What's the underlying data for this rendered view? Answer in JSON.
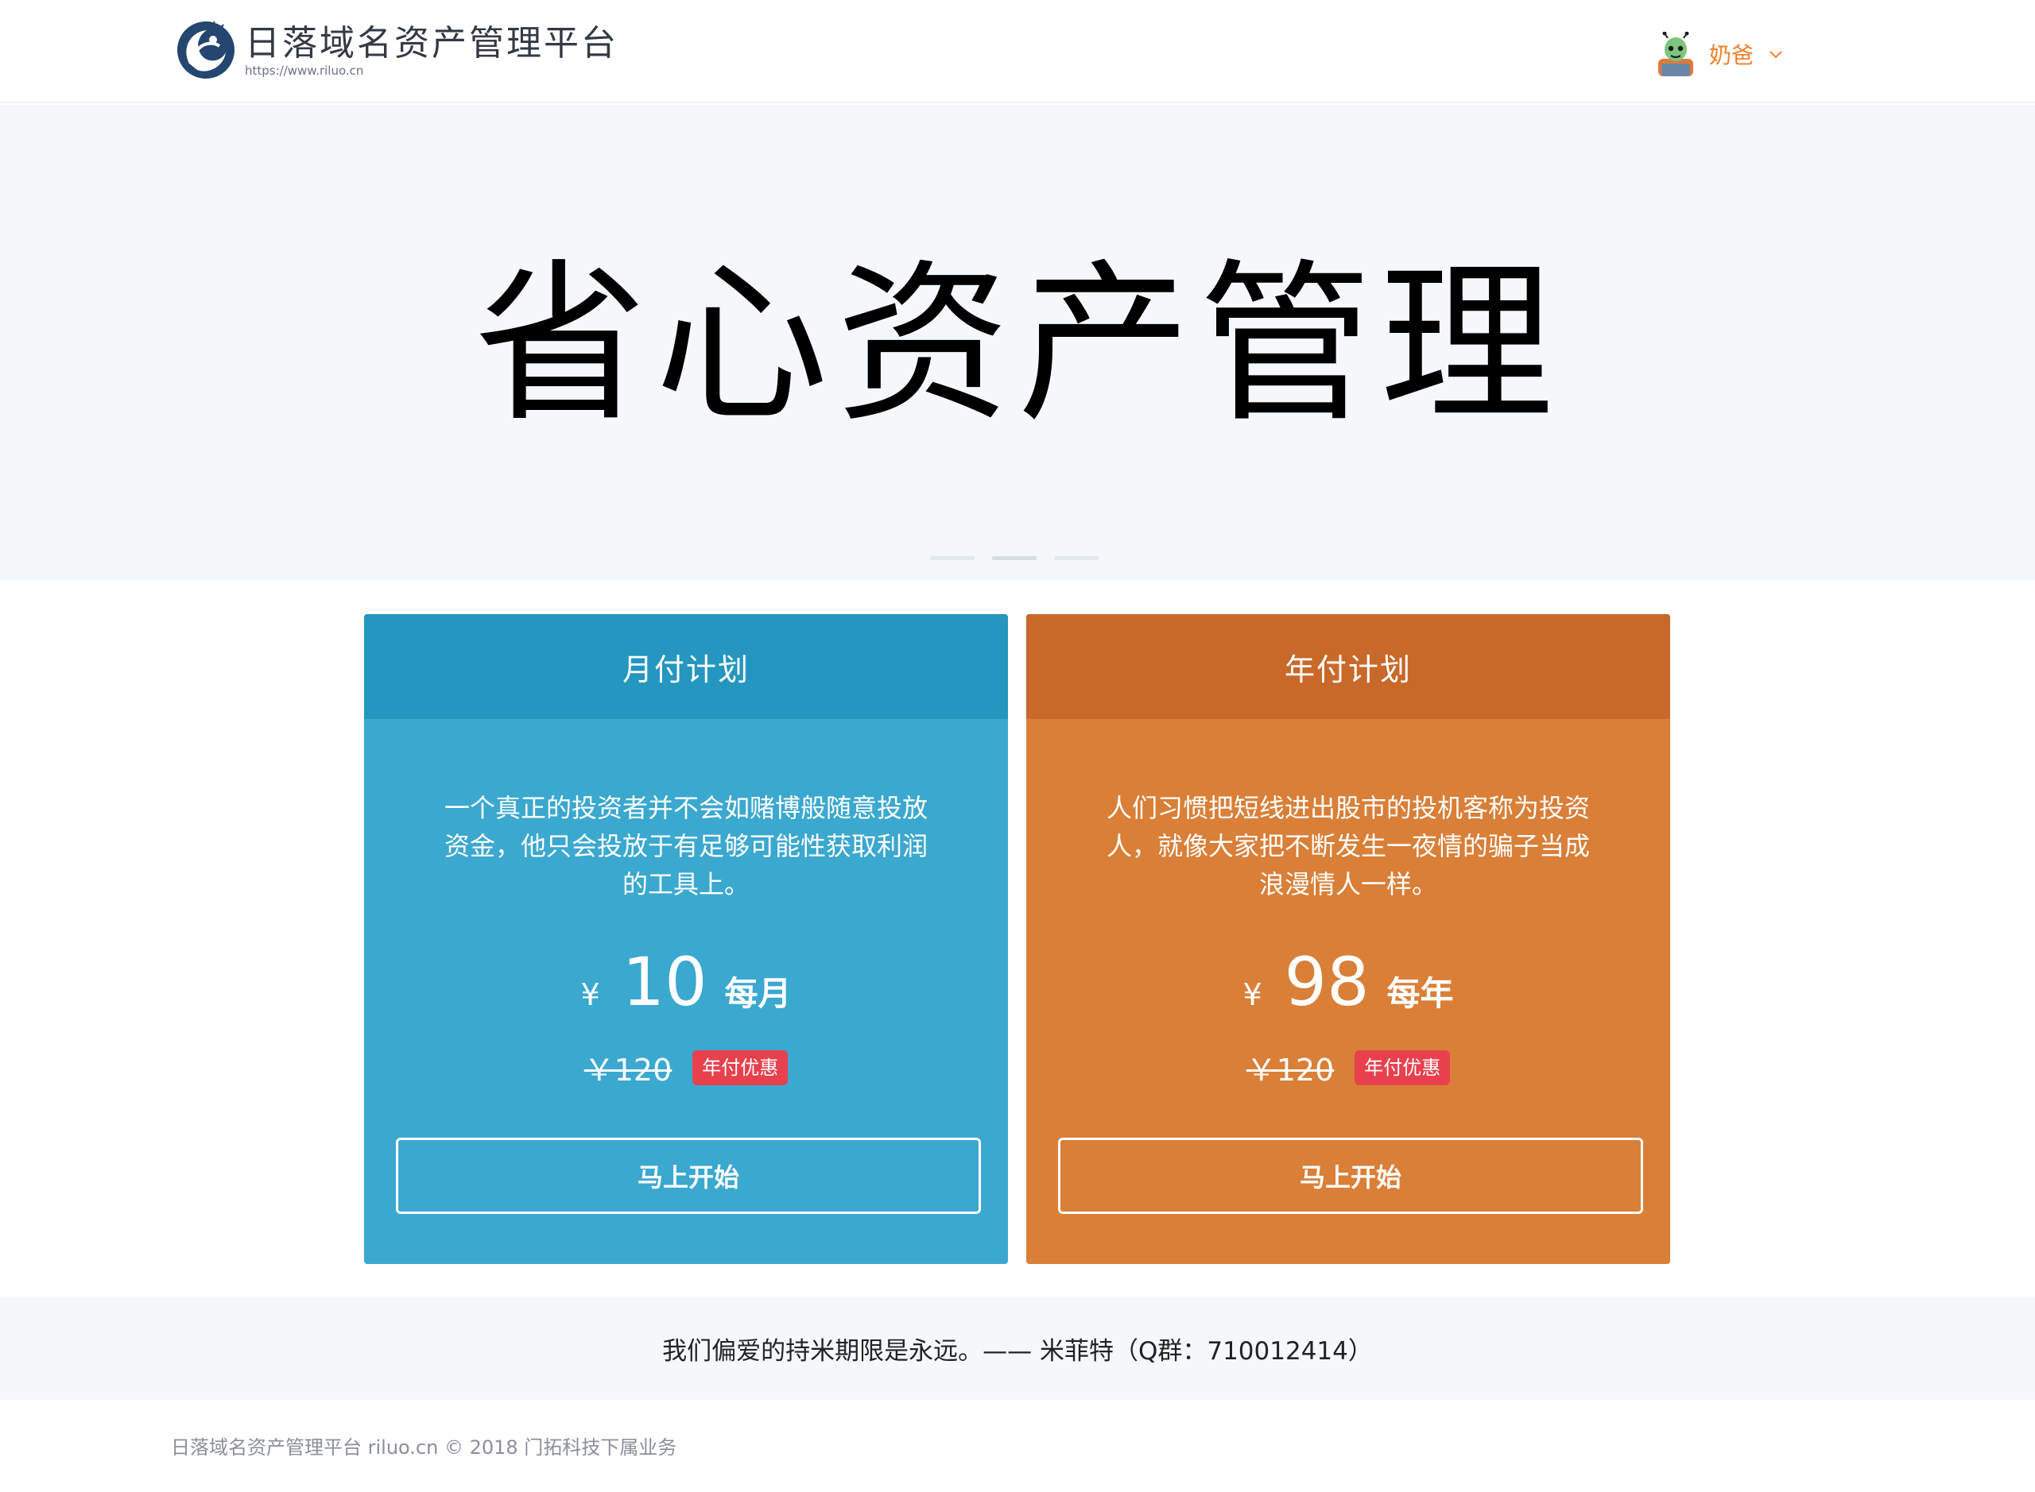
{
  "header": {
    "brand_title": "日落域名资产管理平台",
    "brand_url": "https://www.riluo.cn",
    "user_name": "奶爸"
  },
  "hero": {
    "title": "省心资产管理",
    "slides": 3,
    "active_slide": 2
  },
  "plans": [
    {
      "title": "月付计划",
      "description": "一个真正的投资者并不会如赌博般随意投放资金，他只会投放于有足够可能性获取利润的工具上。",
      "currency": "¥",
      "price": "10",
      "period": "每月",
      "original_price": "￥120",
      "badge": "年付优惠",
      "button": "马上开始",
      "color": "#3ba8cf",
      "header_color": "#2596bf"
    },
    {
      "title": "年付计划",
      "description": "人们习惯把短线进出股市的投机客称为投资人，就像大家把不断发生一夜情的骗子当成浪漫情人一样。",
      "currency": "¥",
      "price": "98",
      "period": "每年",
      "original_price": "￥120",
      "badge": "年付优惠",
      "button": "马上开始",
      "color": "#d97f38",
      "header_color": "#c8692a"
    }
  ],
  "quote": "我们偏爱的持米期限是永远。—— 米菲特（Q群：710012414）",
  "footer": "日落域名资产管理平台 riluo.cn © 2018 门拓科技下属业务",
  "colors": {
    "accent_user": "#f0822c",
    "badge": "#e8414d",
    "hero_bg": "#f5f8fb"
  },
  "icons": {
    "logo": "dragon-logo",
    "avatar": "alien-avatar",
    "dropdown": "chevron-down-icon"
  }
}
